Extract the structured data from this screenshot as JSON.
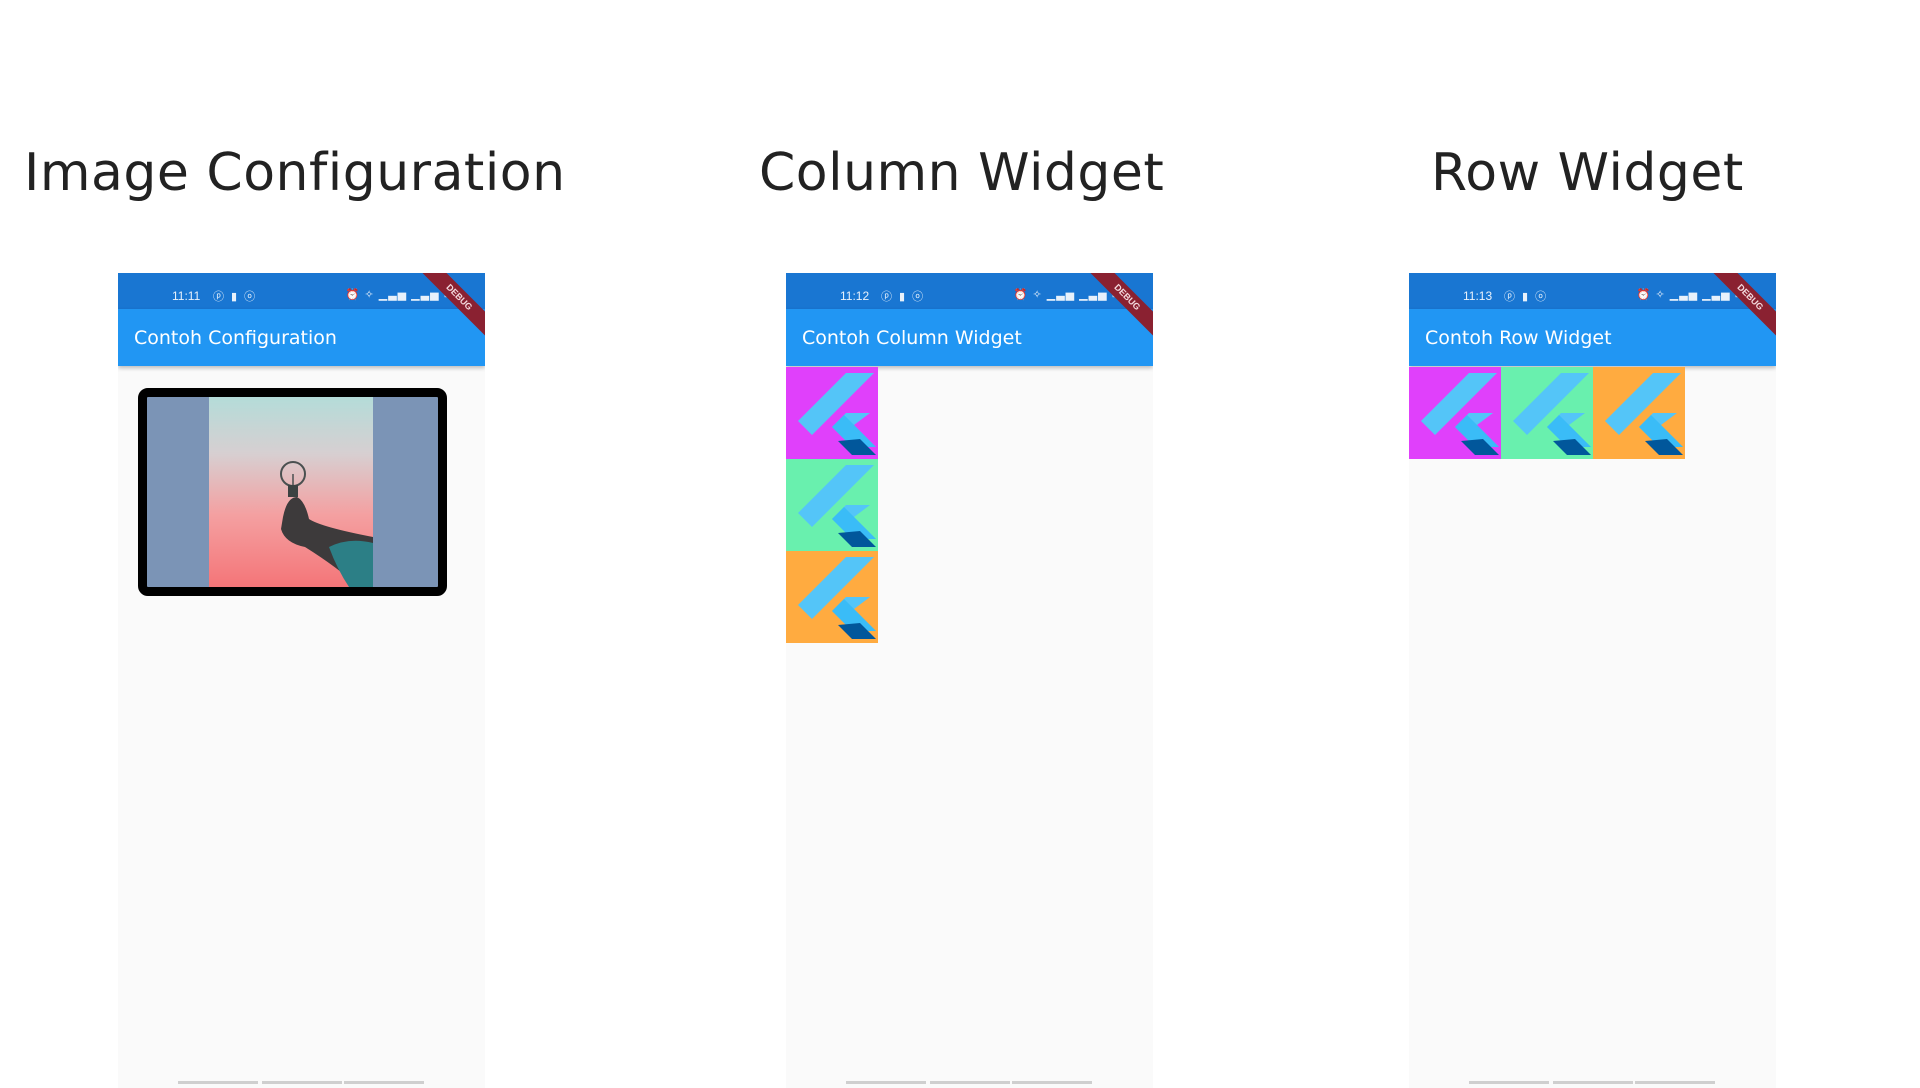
{
  "headings": {
    "image_config": "Image Configuration",
    "column": "Column Widget",
    "row": "Row Widget"
  },
  "phones": [
    {
      "time": "11:11",
      "title": "Contoh Configuration"
    },
    {
      "time": "11:12",
      "title": "Contoh Column Widget"
    },
    {
      "time": "11:13",
      "title": "Contoh Row Widget"
    }
  ],
  "debug_banner": "DEBUG",
  "status_icons": {
    "left": "ⓟ ▮ ⓞ",
    "right": "⏰ ✧ ▁▃▅ ▁▃▅ ▭"
  },
  "tiles": [
    {
      "name": "flutter-logo-tile-purple",
      "color": "#e040fb"
    },
    {
      "name": "flutter-logo-tile-green",
      "color": "#69f0ae"
    },
    {
      "name": "flutter-logo-tile-orange",
      "color": "#ffab40"
    }
  ],
  "colors": {
    "statusbar": "#1976d2",
    "appbar": "#2196f3",
    "frame_bg": "#7b94b6",
    "debug": "#8a2131"
  }
}
